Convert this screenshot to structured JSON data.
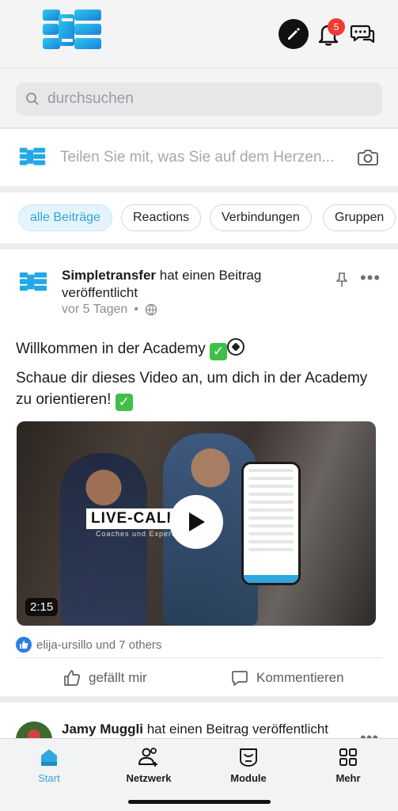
{
  "header": {
    "notification_count": "5",
    "icons": [
      "app-logo",
      "edit-icon",
      "bell-icon",
      "chat-icon"
    ]
  },
  "search": {
    "placeholder": "durchsuchen"
  },
  "composer": {
    "placeholder": "Teilen Sie mit, was Sie auf dem Herzen..."
  },
  "filters": [
    {
      "label": "alle Beiträge",
      "active": true
    },
    {
      "label": "Reactions",
      "active": false
    },
    {
      "label": "Verbindungen",
      "active": false
    },
    {
      "label": "Gruppen",
      "active": false
    }
  ],
  "post": {
    "author": "Simpletransfer",
    "action": " hat einen Beitrag veröffentlicht",
    "time": "vor 5 Tagen",
    "title": "Willkommen in der Academy",
    "body": "Schaue dir dieses Video an, um dich in der Academy zu orientieren!",
    "video": {
      "overlay_title": "LIVE-CALL",
      "overlay_subtitle": "Coaches und Experten",
      "duration": "2:15"
    },
    "likes_text": "elija-ursillo und 7 others",
    "like_label": "gefällt mir",
    "comment_label": "Kommentieren"
  },
  "post2": {
    "author": "Jamy Muggli",
    "action": " hat einen Beitrag veröffentlicht"
  },
  "tabbar": [
    {
      "label": "Start",
      "icon": "home-icon",
      "active": true
    },
    {
      "label": "Netzwerk",
      "icon": "people-icon",
      "active": false
    },
    {
      "label": "Module",
      "icon": "module-icon",
      "active": false
    },
    {
      "label": "Mehr",
      "icon": "grid-icon",
      "active": false
    }
  ],
  "colors": {
    "accent": "#2fa6de",
    "badge": "#ef3b32"
  }
}
